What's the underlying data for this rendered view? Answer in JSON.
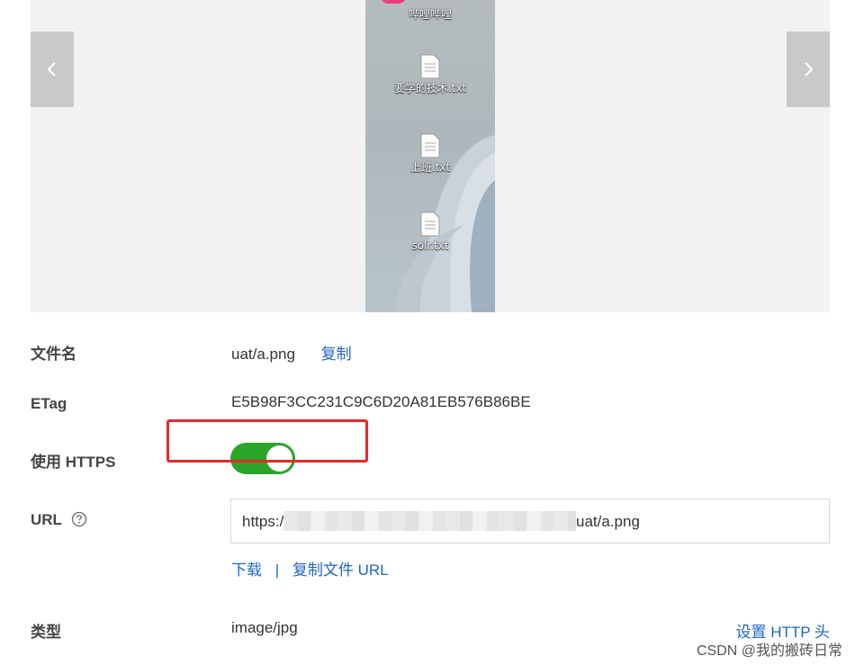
{
  "preview": {
    "prev_icon": "chevron-left-icon",
    "next_icon": "chevron-right-icon",
    "desktop_icons": [
      {
        "label": "哔哩哔哩"
      },
      {
        "label": "要学的技术.txt"
      },
      {
        "label": "上班.txt"
      },
      {
        "label": "solr.txt"
      }
    ]
  },
  "details": {
    "filename_label": "文件名",
    "filename_value": "uat/a.png",
    "copy_link": "复制",
    "etag_label": "ETag",
    "etag_value": "E5B98F3CC231C9C6D20A81EB576B86BE",
    "https_label": "使用 HTTPS",
    "https_enabled": true,
    "url_label": "URL",
    "url_prefix": "https:/",
    "url_suffix": "uat/a.png",
    "download_link": "下载",
    "separator": "|",
    "copy_url_link": "复制文件 URL",
    "type_label": "类型",
    "type_value": "image/jpg",
    "set_header_link": "设置 HTTP 头"
  },
  "watermark": "CSDN @我的搬砖日常",
  "colors": {
    "toggle_on": "#2aa52a",
    "link": "#1f66c4",
    "highlight": "#e32b2b"
  }
}
